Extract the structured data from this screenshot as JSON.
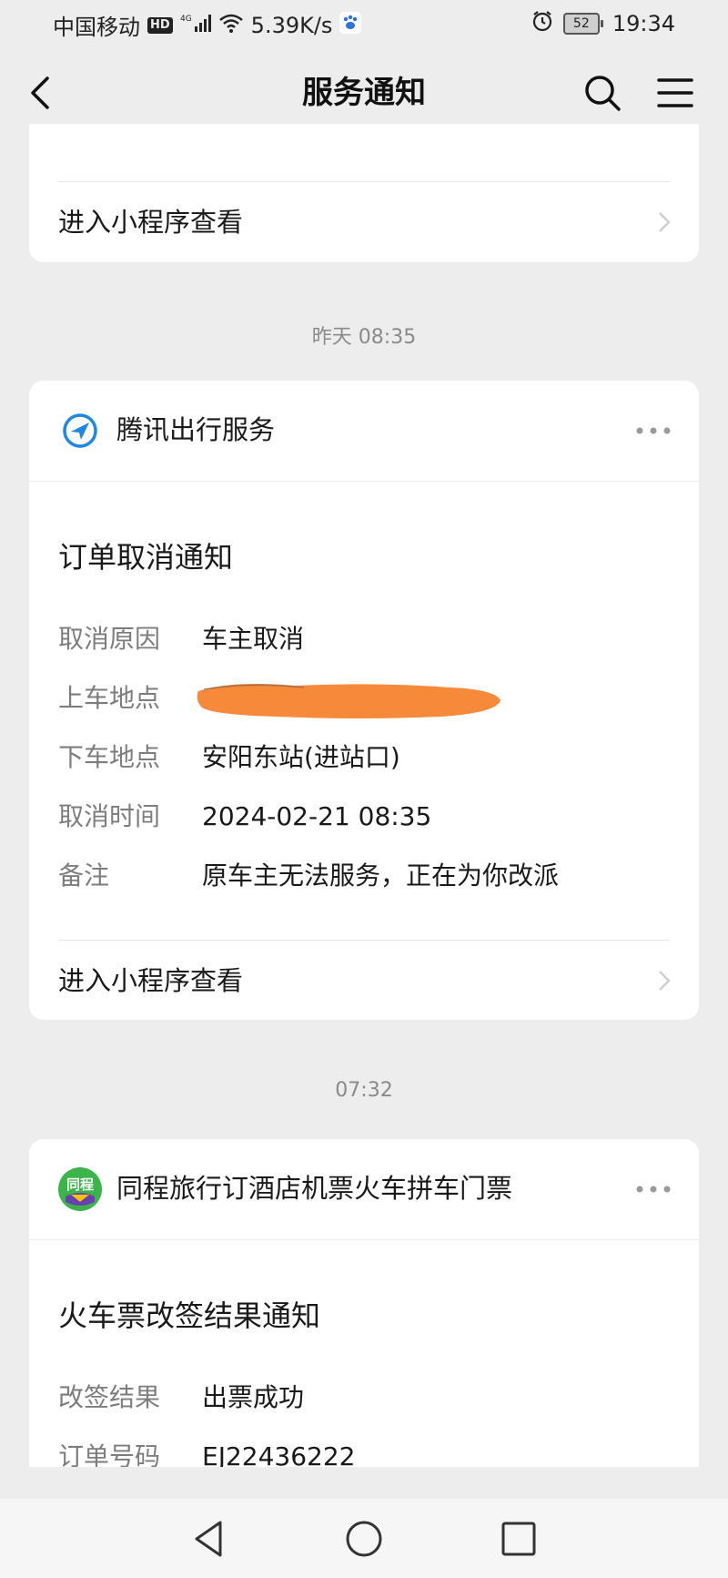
{
  "status_bar": {
    "carrier": "中国移动",
    "hd_badge": "HD",
    "network": "4G",
    "speed": "5.39K/s",
    "battery_level": "52",
    "time": "19:34"
  },
  "nav": {
    "title": "服务通知",
    "back_icon": "chevron-left-icon",
    "search_icon": "search-icon",
    "menu_icon": "menu-icon"
  },
  "card_top": {
    "link_label": "进入小程序查看"
  },
  "timestamp_1": "昨天 08:35",
  "card_tencent": {
    "app_name": "腾讯出行服务",
    "title": "订单取消通知",
    "fields": [
      {
        "label": "取消原因",
        "value": "车主取消"
      },
      {
        "label": "上车地点",
        "value": ""
      },
      {
        "label": "下车地点",
        "value": "安阳东站(进站口)"
      },
      {
        "label": "取消时间",
        "value": "2024-02-21 08:35"
      },
      {
        "label": "备注",
        "value": "原车主无法服务，正在为你改派"
      }
    ],
    "link_label": "进入小程序查看"
  },
  "timestamp_2": "07:32",
  "card_tongcheng": {
    "app_name": "同程旅行订酒店机票火车拼车门票",
    "icon_text": "同程",
    "title": "火车票改签结果通知",
    "fields": [
      {
        "label": "改签结果",
        "value": "出票成功"
      },
      {
        "label": "订单号码",
        "value": "EJ22436222"
      }
    ]
  },
  "colors": {
    "background": "#ededed",
    "card": "#ffffff",
    "tencent_blue": "#1e88e5",
    "tongcheng_green": "#3bb54a",
    "redaction_orange": "#f7893a"
  }
}
